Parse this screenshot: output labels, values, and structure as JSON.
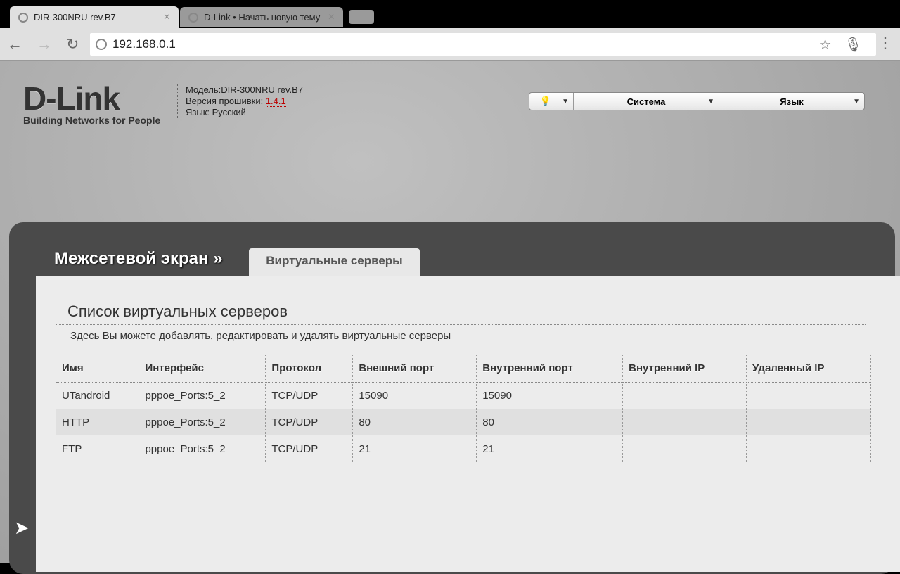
{
  "browser": {
    "tabs": [
      {
        "title": "DIR-300NRU rev.B7"
      },
      {
        "title": "D-Link • Начать новую тему"
      }
    ],
    "url": "192.168.0.1"
  },
  "header": {
    "logo": "D-Link",
    "tagline": "Building Networks for People",
    "model": "Модель:DIR-300NRU rev.B7",
    "firmware_label": "Версия прошивки: ",
    "firmware": "1.4.1",
    "language": "Язык: Русский",
    "system_btn": "Система",
    "lang_btn": "Язык"
  },
  "crumb": "Межсетевой экран »",
  "subtab": "Виртуальные серверы",
  "main": {
    "title": "Список виртуальных серверов",
    "description": "Здесь Вы можете добавлять, редактировать и удалять виртуальные серверы",
    "columns": [
      "Имя",
      "Интерфейс",
      "Протокол",
      "Внешний порт",
      "Внутренний порт",
      "Внутренний IP",
      "Удаленный IP"
    ],
    "rows": [
      [
        "UTandroid",
        "pppoe_Ports:5_2",
        "TCP/UDP",
        "15090",
        "15090",
        "",
        ""
      ],
      [
        "HTTP",
        "pppoe_Ports:5_2",
        "TCP/UDP",
        "80",
        "80",
        "",
        ""
      ],
      [
        "FTP",
        "pppoe_Ports:5_2",
        "TCP/UDP",
        "21",
        "21",
        "",
        ""
      ]
    ]
  }
}
